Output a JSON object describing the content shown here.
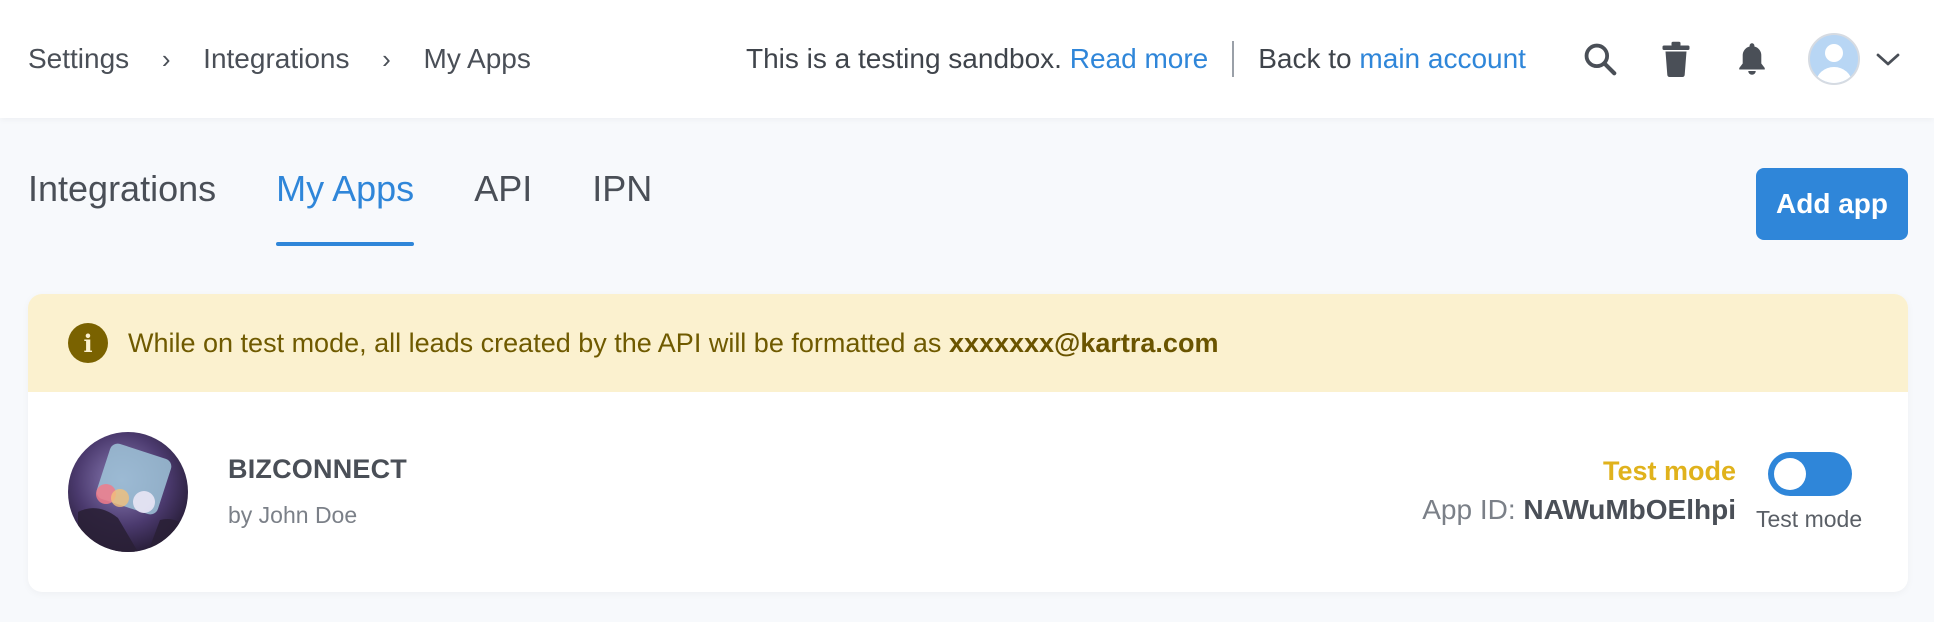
{
  "breadcrumb": {
    "items": [
      "Settings",
      "Integrations",
      "My Apps"
    ],
    "separator": "›"
  },
  "sandbox": {
    "message": "This is a testing sandbox.",
    "read_more": "Read more",
    "back_to": "Back to",
    "main_account": "main account"
  },
  "top_icons": [
    "search-icon",
    "trash-icon",
    "bell-icon",
    "avatar",
    "chevron-down-icon"
  ],
  "tabs": [
    {
      "label": "Integrations",
      "active": false
    },
    {
      "label": "My Apps",
      "active": true
    },
    {
      "label": "API",
      "active": false
    },
    {
      "label": "IPN",
      "active": false
    }
  ],
  "actions": {
    "add_app": "Add app"
  },
  "notice": {
    "icon": "info-icon",
    "icon_glyph": "i",
    "text": "While on test mode, all leads created by the API will be formatted as",
    "email": "xxxxxxx@kartra.com"
  },
  "app": {
    "name": "BIZCONNECT",
    "author": "by John Doe",
    "status": "Test mode",
    "app_id_label": "App ID:",
    "app_id": "NAWuMbOElhpi",
    "toggle_caption": "Test mode",
    "toggle_on": true
  },
  "colors": {
    "accent": "#2f86d9",
    "notice_bg": "#fbf1cf",
    "notice_text": "#6f5a00",
    "test_mode": "#e0b21c"
  }
}
